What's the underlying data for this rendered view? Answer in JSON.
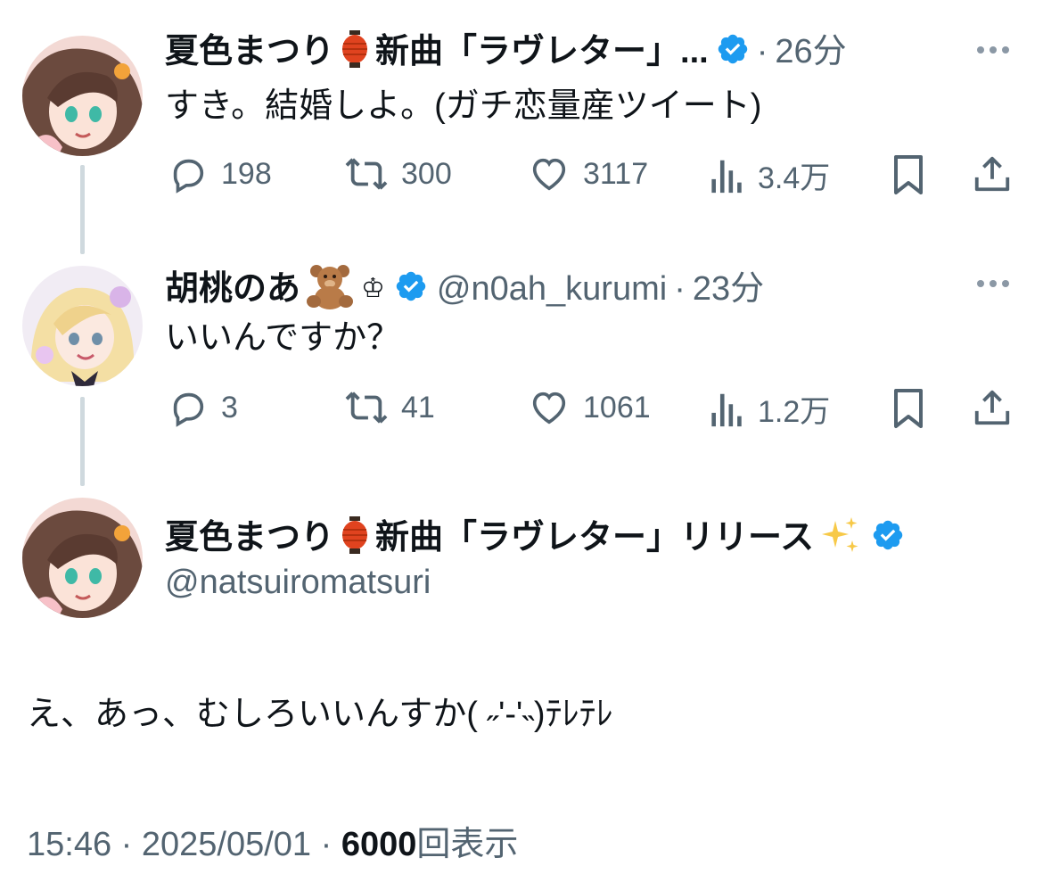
{
  "tweets": [
    {
      "name": "夏色まつり",
      "name_suffix": "新曲「ラヴレター」...",
      "time": "26分",
      "text": "すき。結婚しよ。(ガチ恋量産ツイート)",
      "stats": {
        "replies": "198",
        "retweets": "300",
        "likes": "3117",
        "views": "3.4万"
      }
    },
    {
      "name": "胡桃のあ",
      "crown": "♔",
      "handle": "@n0ah_kurumi",
      "time": "23分",
      "text": "いいんですか？",
      "stats": {
        "replies": "3",
        "retweets": "41",
        "likes": "1061",
        "views": "1.2万"
      }
    }
  ],
  "main_tweet": {
    "name": "夏色まつり",
    "name_suffix": "新曲「ラヴレター」リリース",
    "handle": "@natsuiromatsuri",
    "text": "え、あっ、むしろいいんすか( ˶'-'˵)ﾃﾚﾃﾚ",
    "time": "15:46",
    "date": "2025/05/01",
    "views_count": "6000",
    "views_label": "回表示"
  },
  "separator": "·",
  "colors": {
    "verified": "#1d9bf0",
    "secondary": "#536471",
    "thread_line": "#cfd9de"
  },
  "icons": [
    "lantern-icon",
    "teddy-bear-icon",
    "sparkles-icon",
    "verified-icon",
    "reply-icon",
    "retweet-icon",
    "like-icon",
    "views-icon",
    "bookmark-icon",
    "share-icon",
    "more-icon"
  ]
}
